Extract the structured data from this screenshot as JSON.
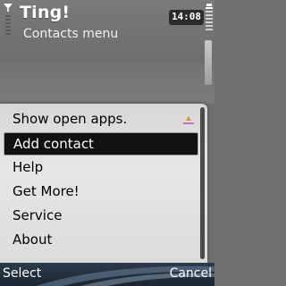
{
  "header": {
    "title": "Ting!",
    "subtitle": "Contacts menu",
    "clock": "14:08",
    "signal_icon": "signal-strength-icon",
    "battery_icon": "battery-level-icon"
  },
  "menu": {
    "items": [
      {
        "label": "Show open apps.",
        "icon": "open-apps-icon"
      },
      {
        "label": "Add contact",
        "selected": true
      },
      {
        "label": "Help"
      },
      {
        "label": "Get More!"
      },
      {
        "label": "Service",
        "submenu": true
      },
      {
        "label": "About"
      }
    ]
  },
  "softkeys": {
    "left": "Select",
    "right": "Cancel"
  },
  "colors": {
    "selection": "#111111",
    "menu_background": "#e0e0e0",
    "softkey_bar": "#1c2531"
  }
}
